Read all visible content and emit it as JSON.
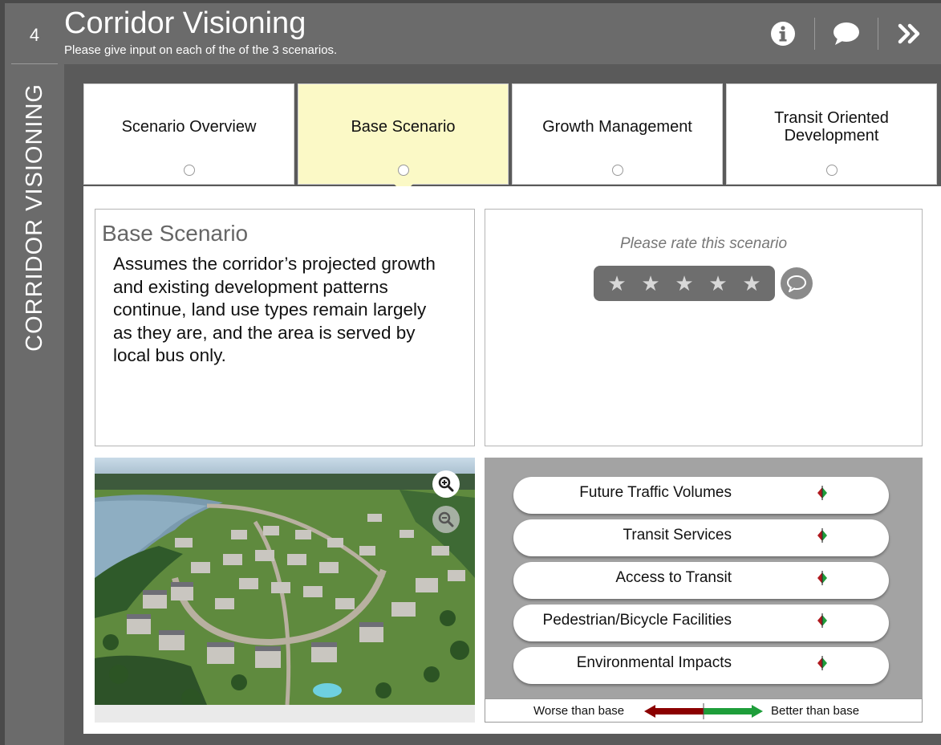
{
  "sidebar": {
    "step_number": "4",
    "vertical_title": "CORRIDOR VISIONING"
  },
  "header": {
    "title": "Corridor Visioning",
    "subtitle": "Please give input on each of the of the 3 scenarios.",
    "icons": [
      "info-icon",
      "comment-icon",
      "double-chevron-right-icon"
    ]
  },
  "tabs": [
    {
      "label": "Scenario Overview",
      "active": false
    },
    {
      "label": "Base Scenario",
      "active": true
    },
    {
      "label": "Growth Management",
      "active": false
    },
    {
      "label": "Transit Oriented Development",
      "active": false
    }
  ],
  "description": {
    "title": "Base Scenario",
    "text": "Assumes the corridor’s projected growth and existing development patterns continue, land use types remain largely as they are, and the area is served by local bus only."
  },
  "rating": {
    "prompt": "Please rate this scenario",
    "max_stars": 5,
    "current_rating": 0
  },
  "image": {
    "zoom_in_icon": "zoom-in-icon",
    "zoom_out_icon": "zoom-out-icon"
  },
  "impacts": {
    "items": [
      {
        "label": "Future Traffic Volumes"
      },
      {
        "label": "Transit Services"
      },
      {
        "label": "Access to Transit"
      },
      {
        "label": "Pedestrian/Bicycle Facilities"
      },
      {
        "label": "Environmental Impacts"
      }
    ],
    "legend": {
      "worse": "Worse than base",
      "better": "Better than base",
      "worse_color": "#8b0000",
      "better_color": "#1e9e3a"
    }
  },
  "colors": {
    "active_tab": "#fbf9c6",
    "chrome": "#6b6b6b",
    "background": "#4a4a4a"
  }
}
